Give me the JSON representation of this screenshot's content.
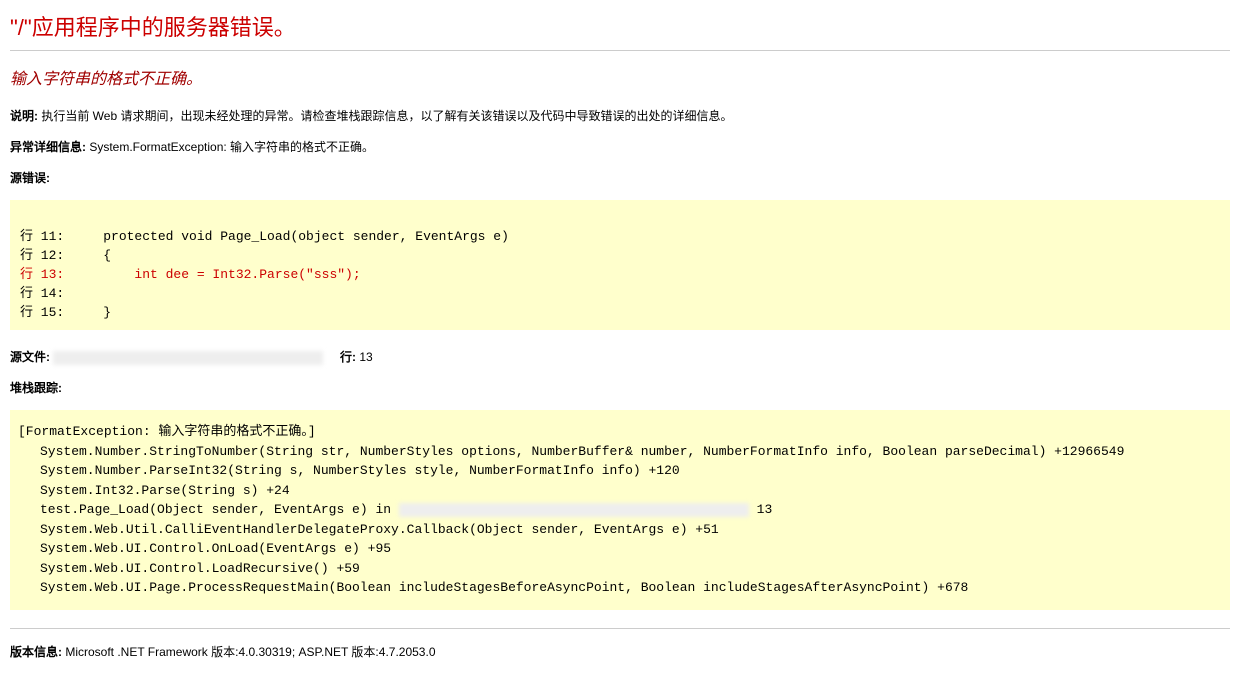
{
  "header": {
    "title": "\"/\"应用程序中的服务器错误。",
    "subtitle": "输入字符串的格式不正确。"
  },
  "labels": {
    "description": "说明:",
    "exception_details": "异常详细信息:",
    "source_error": "源错误:",
    "source_file": "源文件:",
    "line": "行:",
    "stack_trace": "堆栈跟踪:",
    "version_info": "版本信息:"
  },
  "description_text": " 执行当前 Web 请求期间，出现未经处理的异常。请检查堆栈跟踪信息，以了解有关该错误以及代码中导致错误的出处的详细信息。",
  "exception_text": " System.FormatException: 输入字符串的格式不正确。",
  "source_code": {
    "line11": "行 11:     protected void Page_Load(object sender, EventArgs e)",
    "line12": "行 12:     {",
    "line13": "行 13:         int dee = Int32.Parse(\"sss\");",
    "line14": "行 14: ",
    "line15": "行 15:     }"
  },
  "source_file_line": "13",
  "stack": {
    "header": "[FormatException: 输入字符串的格式不正确。]",
    "s1": "System.Number.StringToNumber(String str, NumberStyles options, NumberBuffer& number, NumberFormatInfo info, Boolean parseDecimal) +12966549",
    "s2": "System.Number.ParseInt32(String s, NumberStyles style, NumberFormatInfo info) +120",
    "s3": "System.Int32.Parse(String s) +24",
    "s4a": "test.Page_Load(Object sender, EventArgs e) in ",
    "s4b": " 13",
    "s5": "System.Web.Util.CalliEventHandlerDelegateProxy.Callback(Object sender, EventArgs e) +51",
    "s6": "System.Web.UI.Control.OnLoad(EventArgs e) +95",
    "s7": "System.Web.UI.Control.LoadRecursive() +59",
    "s8": "System.Web.UI.Page.ProcessRequestMain(Boolean includeStagesBeforeAsyncPoint, Boolean includeStagesAfterAsyncPoint) +678"
  },
  "version_text": " Microsoft .NET Framework 版本:4.0.30319; ASP.NET 版本:4.7.2053.0"
}
